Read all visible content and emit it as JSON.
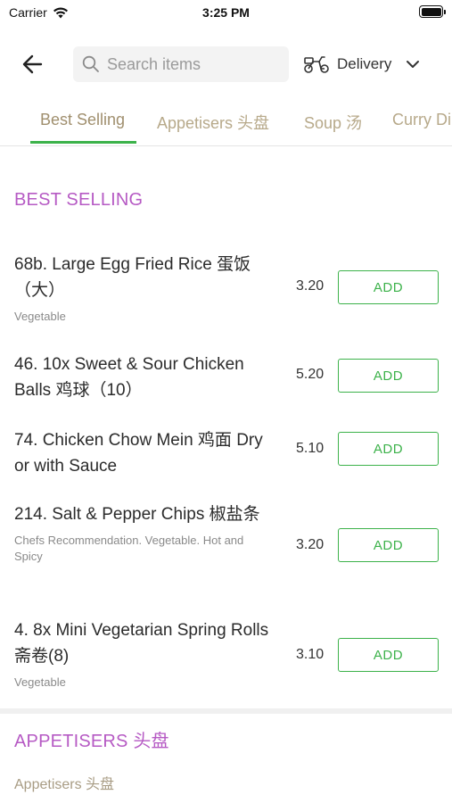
{
  "status_bar": {
    "carrier": "Carrier",
    "time": "3:25 PM"
  },
  "header": {
    "search_placeholder": "Search items",
    "delivery_label": "Delivery"
  },
  "tabs": [
    {
      "label": "Best Selling",
      "active": true
    },
    {
      "label": "Appetisers 头盘",
      "active": false
    },
    {
      "label": "Soup 汤",
      "active": false
    },
    {
      "label": "Curry Di",
      "active": false
    }
  ],
  "sections": [
    {
      "title": "BEST SELLING",
      "items": [
        {
          "name": "68b. Large Egg Fried Rice 蛋饭（大）",
          "desc": "Vegetable",
          "price": "3.20",
          "button": "ADD"
        },
        {
          "name": "46. 10x Sweet & Sour Chicken Balls 鸡球（10）",
          "desc": "",
          "price": "5.20",
          "button": "ADD"
        },
        {
          "name": "74. Chicken Chow Mein 鸡面 Dry or with Sauce",
          "desc": "",
          "price": "5.10",
          "button": "ADD"
        },
        {
          "name": "214. Salt & Pepper Chips 椒盐条",
          "desc": "Chefs Recommendation. Vegetable. Hot and Spicy",
          "price": "3.20",
          "button": "ADD"
        },
        {
          "name": "4. 8x Mini Vegetarian Spring Rolls 斋卷(8)",
          "desc": "Vegetable",
          "price": "3.10",
          "button": "ADD"
        }
      ]
    },
    {
      "title": "APPETISERS 头盘",
      "subtitle": "Appetisers 头盘"
    }
  ],
  "colors": {
    "accent_green": "#3cb24a",
    "section_purple": "#b65ac4",
    "tab_gold": "#b7a98a"
  },
  "icons": [
    "wifi-icon",
    "battery-icon",
    "back-arrow-icon",
    "search-icon",
    "scooter-icon",
    "chevron-down-icon"
  ]
}
